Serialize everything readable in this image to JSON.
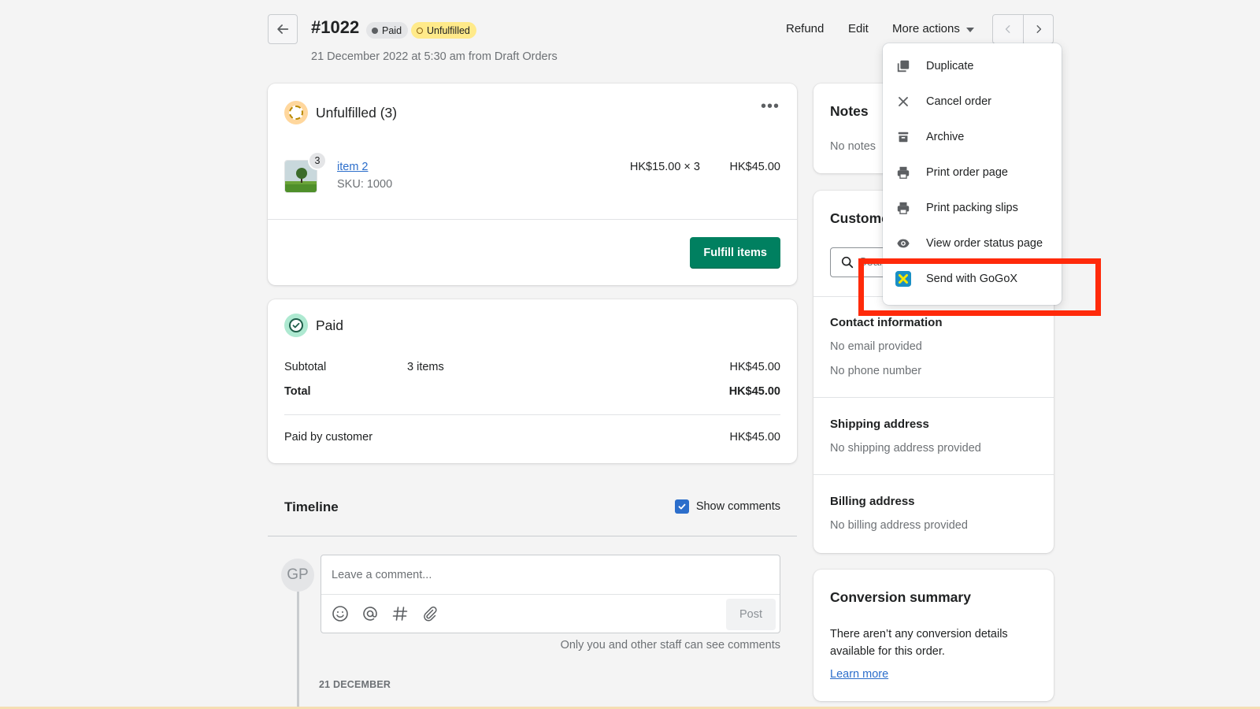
{
  "header": {
    "order_number": "#1022",
    "badges": [
      {
        "label": "Paid",
        "style": "neutral",
        "color": "#e4e5e7"
      },
      {
        "label": "Unfulfilled",
        "style": "attention",
        "color": "#ffea8a"
      }
    ],
    "subtitle": "21 December 2022 at 5:30 am from Draft Orders",
    "actions": {
      "refund": "Refund",
      "edit": "Edit",
      "more_actions": "More actions"
    },
    "icons": {
      "back": "arrow-left-icon",
      "prev": "chevron-left-icon",
      "next": "chevron-right-icon"
    }
  },
  "more_actions_menu": {
    "items": [
      {
        "label": "Duplicate",
        "icon": "duplicate-icon"
      },
      {
        "label": "Cancel order",
        "icon": "close-icon"
      },
      {
        "label": "Archive",
        "icon": "archive-icon"
      },
      {
        "label": "Print order page",
        "icon": "printer-icon"
      },
      {
        "label": "Print packing slips",
        "icon": "printer-icon"
      },
      {
        "label": "View order status page",
        "icon": "eye-icon"
      },
      {
        "label": "Send with GoGoX",
        "icon": "gogox-app-icon",
        "highlighted": true
      }
    ],
    "highlight_color": "#ff2a0a"
  },
  "fulfillment": {
    "title": "Unfulfilled (3)",
    "line_items": [
      {
        "name": "item 2",
        "sku": "SKU: 1000",
        "quantity": "3",
        "unit_price": "HK$15.00 × 3",
        "total": "HK$45.00"
      }
    ],
    "fulfill_button": "Fulfill items",
    "accent_color": "#008060"
  },
  "payment": {
    "title": "Paid",
    "rows": {
      "subtotal_label": "Subtotal",
      "subtotal_items": "3 items",
      "subtotal_value": "HK$45.00",
      "total_label": "Total",
      "total_value": "HK$45.00",
      "paid_label": "Paid by customer",
      "paid_value": "HK$45.00"
    }
  },
  "timeline": {
    "title": "Timeline",
    "show_comments_label": "Show comments",
    "show_comments_checked": true,
    "avatar_initials": "GP",
    "comment_placeholder": "Leave a comment...",
    "post_button": "Post",
    "visibility_note": "Only you and other staff can see comments",
    "date_header": "21 DECEMBER",
    "tool_icons": [
      "emoji-icon",
      "mention-icon",
      "hashtag-icon",
      "attachment-icon"
    ]
  },
  "notes": {
    "title": "Notes",
    "text": "No notes"
  },
  "customer": {
    "title": "Customer",
    "search_placeholder": "Search or create a customer",
    "contact_title": "Contact information",
    "no_email": "No email provided",
    "no_phone": "No phone number",
    "shipping_title": "Shipping address",
    "no_shipping": "No shipping address provided",
    "billing_title": "Billing address",
    "no_billing": "No billing address provided"
  },
  "conversion": {
    "title": "Conversion summary",
    "text": "There aren’t any conversion details available for this order.",
    "link": "Learn more"
  }
}
